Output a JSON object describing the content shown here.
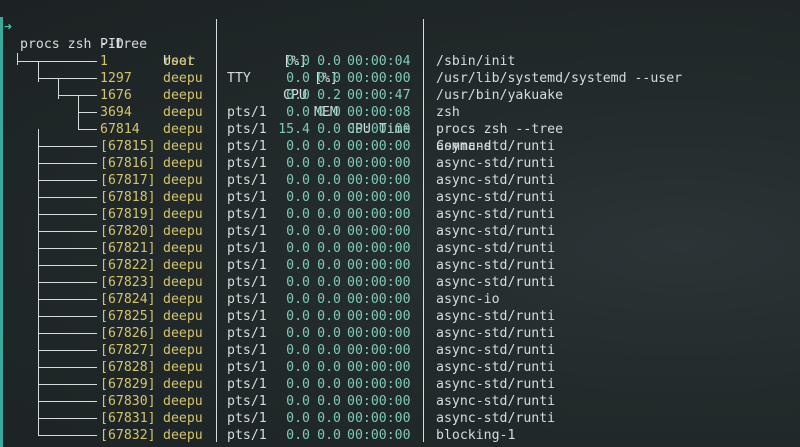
{
  "prompt": {
    "arrow": "➜",
    "command": "procs zsh --tree"
  },
  "headers": {
    "pid": "PID",
    "user": "User",
    "tty": "TTY",
    "cpu": "CPU",
    "cpu2": "[%]",
    "mem": "MEM",
    "mem2": "[%]",
    "time": "CPU Time",
    "command": "Command"
  },
  "rows": [
    {
      "pid": "1",
      "user": "root",
      "tty": "",
      "cpu": "0.0",
      "mem": "0.0",
      "time": "00:00:04",
      "cmd": "/sbin/init"
    },
    {
      "pid": "1297",
      "user": "deepu",
      "tty": "",
      "cpu": "0.0",
      "mem": "0.0",
      "time": "00:00:00",
      "cmd": "/usr/lib/systemd/systemd --user"
    },
    {
      "pid": "1676",
      "user": "deepu",
      "tty": "",
      "cpu": "0.0",
      "mem": "0.2",
      "time": "00:00:47",
      "cmd": "/usr/bin/yakuake"
    },
    {
      "pid": "3694",
      "user": "deepu",
      "tty": "pts/1",
      "cpu": "0.0",
      "mem": "0.0",
      "time": "00:00:08",
      "cmd": "zsh"
    },
    {
      "pid": "67814",
      "user": "deepu",
      "tty": "pts/1",
      "cpu": "15.4",
      "mem": "0.0",
      "time": "00:00:00",
      "cmd": "procs zsh --tree"
    },
    {
      "pid": "[67815]",
      "user": "deepu",
      "tty": "pts/1",
      "cpu": "0.0",
      "mem": "0.0",
      "time": "00:00:00",
      "cmd": "async-std/runti"
    },
    {
      "pid": "[67816]",
      "user": "deepu",
      "tty": "pts/1",
      "cpu": "0.0",
      "mem": "0.0",
      "time": "00:00:00",
      "cmd": "async-std/runti"
    },
    {
      "pid": "[67817]",
      "user": "deepu",
      "tty": "pts/1",
      "cpu": "0.0",
      "mem": "0.0",
      "time": "00:00:00",
      "cmd": "async-std/runti"
    },
    {
      "pid": "[67818]",
      "user": "deepu",
      "tty": "pts/1",
      "cpu": "0.0",
      "mem": "0.0",
      "time": "00:00:00",
      "cmd": "async-std/runti"
    },
    {
      "pid": "[67819]",
      "user": "deepu",
      "tty": "pts/1",
      "cpu": "0.0",
      "mem": "0.0",
      "time": "00:00:00",
      "cmd": "async-std/runti"
    },
    {
      "pid": "[67820]",
      "user": "deepu",
      "tty": "pts/1",
      "cpu": "0.0",
      "mem": "0.0",
      "time": "00:00:00",
      "cmd": "async-std/runti"
    },
    {
      "pid": "[67821]",
      "user": "deepu",
      "tty": "pts/1",
      "cpu": "0.0",
      "mem": "0.0",
      "time": "00:00:00",
      "cmd": "async-std/runti"
    },
    {
      "pid": "[67822]",
      "user": "deepu",
      "tty": "pts/1",
      "cpu": "0.0",
      "mem": "0.0",
      "time": "00:00:00",
      "cmd": "async-std/runti"
    },
    {
      "pid": "[67823]",
      "user": "deepu",
      "tty": "pts/1",
      "cpu": "0.0",
      "mem": "0.0",
      "time": "00:00:00",
      "cmd": "async-std/runti"
    },
    {
      "pid": "[67824]",
      "user": "deepu",
      "tty": "pts/1",
      "cpu": "0.0",
      "mem": "0.0",
      "time": "00:00:00",
      "cmd": "async-io"
    },
    {
      "pid": "[67825]",
      "user": "deepu",
      "tty": "pts/1",
      "cpu": "0.0",
      "mem": "0.0",
      "time": "00:00:00",
      "cmd": "async-std/runti"
    },
    {
      "pid": "[67826]",
      "user": "deepu",
      "tty": "pts/1",
      "cpu": "0.0",
      "mem": "0.0",
      "time": "00:00:00",
      "cmd": "async-std/runti"
    },
    {
      "pid": "[67827]",
      "user": "deepu",
      "tty": "pts/1",
      "cpu": "0.0",
      "mem": "0.0",
      "time": "00:00:00",
      "cmd": "async-std/runti"
    },
    {
      "pid": "[67828]",
      "user": "deepu",
      "tty": "pts/1",
      "cpu": "0.0",
      "mem": "0.0",
      "time": "00:00:00",
      "cmd": "async-std/runti"
    },
    {
      "pid": "[67829]",
      "user": "deepu",
      "tty": "pts/1",
      "cpu": "0.0",
      "mem": "0.0",
      "time": "00:00:00",
      "cmd": "async-std/runti"
    },
    {
      "pid": "[67830]",
      "user": "deepu",
      "tty": "pts/1",
      "cpu": "0.0",
      "mem": "0.0",
      "time": "00:00:00",
      "cmd": "async-std/runti"
    },
    {
      "pid": "[67831]",
      "user": "deepu",
      "tty": "pts/1",
      "cpu": "0.0",
      "mem": "0.0",
      "time": "00:00:00",
      "cmd": "async-std/runti"
    },
    {
      "pid": "[67832]",
      "user": "deepu",
      "tty": "pts/1",
      "cpu": "0.0",
      "mem": "0.0",
      "time": "00:00:00",
      "cmd": "blocking-1"
    }
  ],
  "colors": {
    "pid": "#d5c46a",
    "user": "#d5c46a",
    "numeric": "#7fc9bb",
    "text": "#d3dde0",
    "background": "#1f2627",
    "edge": "#3ba99b"
  }
}
